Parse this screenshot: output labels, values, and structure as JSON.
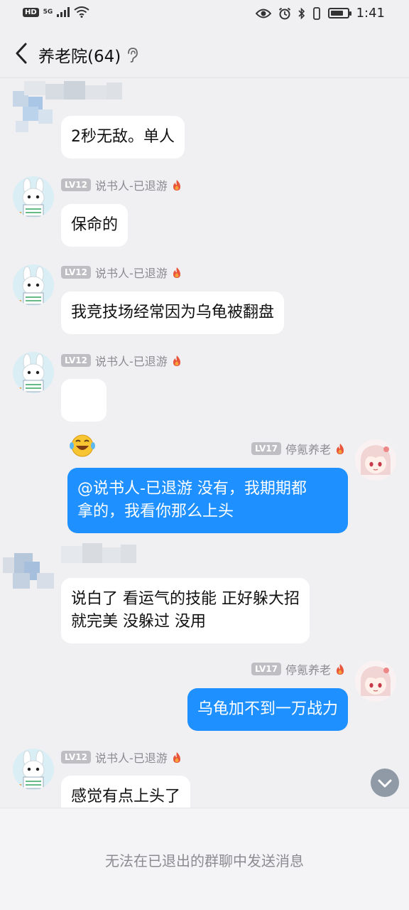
{
  "status_bar": {
    "hd_label": "HD",
    "network_label": "5G",
    "time": "1:41",
    "battery_level": 0.8
  },
  "header": {
    "title": "养老院(64)"
  },
  "messages": [
    {
      "sender": "",
      "level": "",
      "text": "2秒无敌。单人"
    },
    {
      "sender": "说书人-已退游",
      "level": "LV12",
      "text": "保命的"
    },
    {
      "sender": "说书人-已退游",
      "level": "LV12",
      "text": "我竞技场经常因为乌龟被翻盘"
    },
    {
      "sender": "说书人-已退游",
      "level": "LV12",
      "text": "😂"
    },
    {
      "sender": "停氪养老",
      "level": "LV17",
      "text": "@说书人-已退游 没有，我期期都\n拿的，我看你那么上头"
    },
    {
      "sender": "",
      "level": "",
      "text": "说白了 看运气的技能 正好躲大招\n就完美 没躲过 没用"
    },
    {
      "sender": "停氪养老",
      "level": "LV17",
      "text": "乌龟加不到一万战力"
    },
    {
      "sender": "说书人-已退游",
      "level": "LV12",
      "text": "感觉有点上头了"
    }
  ],
  "footer": {
    "notice": "无法在已退出的群聊中发送消息"
  },
  "colors": {
    "background": "#f0f0f3",
    "incoming_bubble": "#ffffff",
    "outgoing_bubble": "#1e90ff",
    "level_badge": "#bfbfc3",
    "nickname": "#8c8c90",
    "flame": "#e8553b"
  },
  "icons": [
    "back-arrow-icon",
    "ear-icon",
    "flame-icon",
    "chevron-down-icon",
    "eye-icon",
    "alarm-icon",
    "bluetooth-icon",
    "vibrate-icon",
    "wifi-icon",
    "battery-icon"
  ]
}
